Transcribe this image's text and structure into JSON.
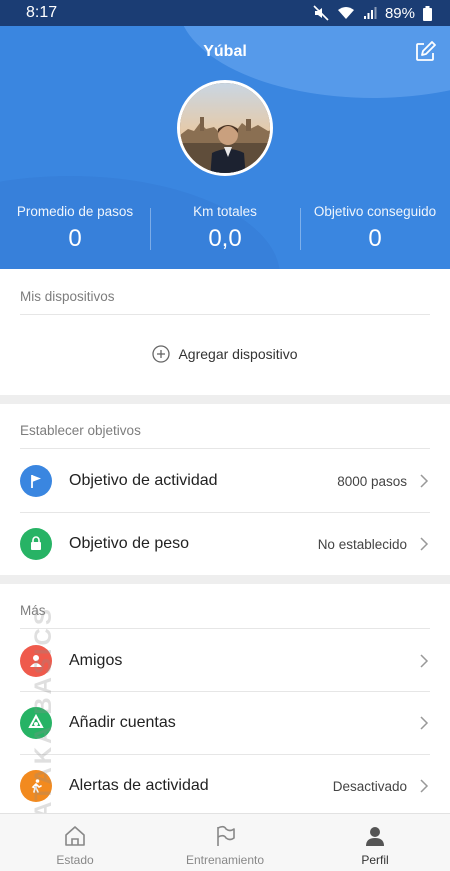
{
  "status_bar": {
    "time": "8:17",
    "battery": "89%"
  },
  "profile": {
    "name": "Yúbal",
    "stats": [
      {
        "label": "Promedio de pasos",
        "value": "0"
      },
      {
        "label": "Km totales",
        "value": "0,0"
      },
      {
        "label": "Objetivo conseguido",
        "value": "0"
      }
    ]
  },
  "devices": {
    "title": "Mis dispositivos",
    "add_label": "Agregar dispositivo"
  },
  "goals": {
    "title": "Establecer objetivos",
    "items": [
      {
        "label": "Objetivo de actividad",
        "value": "8000 pasos",
        "icon": "flag-icon",
        "color": "#3a86e0"
      },
      {
        "label": "Objetivo de peso",
        "value": "No establecido",
        "icon": "bag-icon",
        "color": "#27b365"
      }
    ]
  },
  "more": {
    "title": "Más",
    "items": [
      {
        "label": "Amigos",
        "value": "",
        "icon": "person-icon",
        "color": "#ef5a4c"
      },
      {
        "label": "Añadir cuentas",
        "value": "",
        "icon": "sync-icon",
        "color": "#27b365"
      },
      {
        "label": "Alertas de actividad",
        "value": "Desactivado",
        "icon": "runner-icon",
        "color": "#f28a1f"
      }
    ]
  },
  "bottom_nav": {
    "items": [
      {
        "label": "Estado",
        "icon": "home-icon"
      },
      {
        "label": "Entrenamiento",
        "icon": "flag-outline-icon"
      },
      {
        "label": "Perfil",
        "icon": "profile-icon",
        "active": true
      }
    ]
  },
  "watermark": "XATAKA BASICS",
  "colors": {
    "header": "#3a86e0",
    "status_bar": "#1b3d74"
  }
}
